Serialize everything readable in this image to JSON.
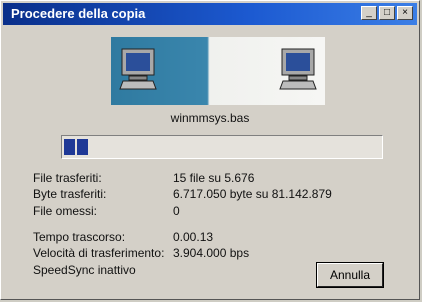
{
  "window": {
    "title": "Procedere della copia",
    "controls": {
      "minimize": "_",
      "maximize": "□",
      "close": "×"
    }
  },
  "animation": {
    "source": "computer-icon",
    "target": "computer-icon"
  },
  "current_file": "winmmsys.bas",
  "progress": {
    "fraction": 0.08
  },
  "stats": [
    {
      "label": "File trasferiti:",
      "value": "15 file su 5.676"
    },
    {
      "label": "Byte trasferiti:",
      "value": "6.717.050 byte su 81.142.879"
    },
    {
      "label": "File omessi:",
      "value": "0"
    },
    {
      "label": "Tempo trascorso:",
      "value": "0.00.13"
    },
    {
      "label": "Velocità di trasferimento:",
      "value": "3.904.000 bps"
    }
  ],
  "speedsync": "SpeedSync inattivo",
  "cancel_label": "Annulla"
}
